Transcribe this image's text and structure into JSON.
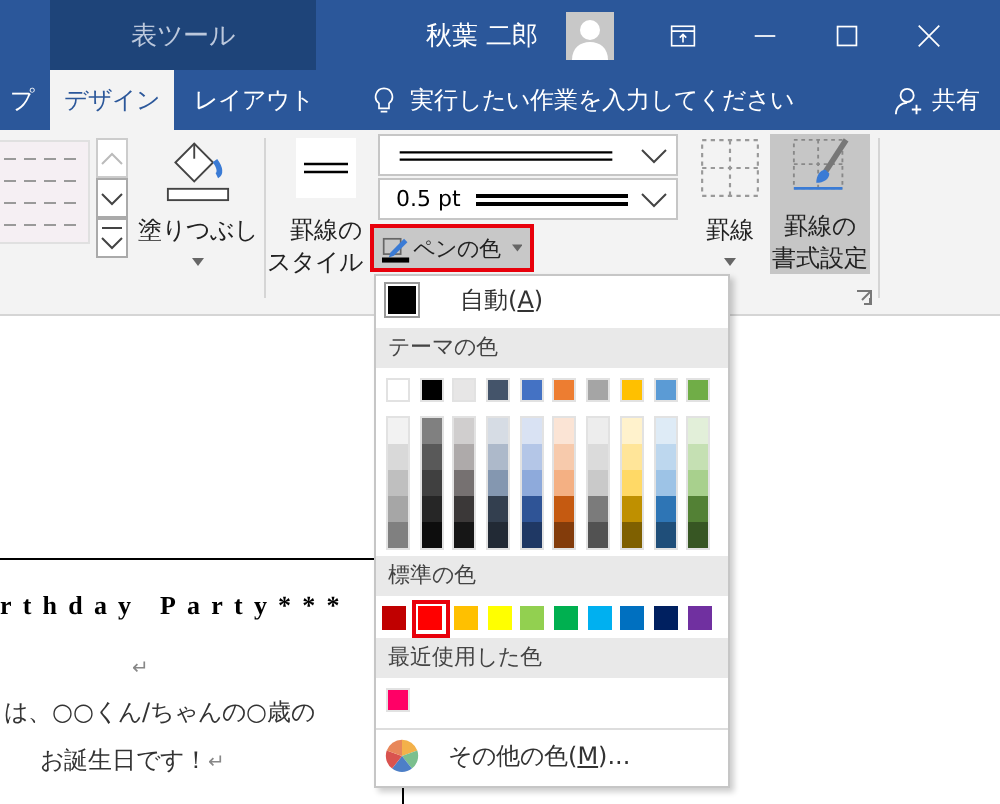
{
  "title_bar": {
    "contextual_tab_group": "表ツール",
    "user_name": "秋葉 二郎"
  },
  "tabs": [
    {
      "label": "プ",
      "selected": false
    },
    {
      "label": "デザイン",
      "selected": true
    },
    {
      "label": "レイアウト",
      "selected": false
    }
  ],
  "tell_me": {
    "placeholder": "実行したい作業を入力してください"
  },
  "share_button": {
    "label": "共有"
  },
  "ribbon": {
    "shading_label": "塗りつぶし",
    "border_styles_label": [
      "罫線の",
      "スタイル"
    ],
    "line_weight": "0.5 pt",
    "pen_color_button": {
      "label": "ペンの色",
      "highlighted": true
    },
    "borders_label": "罫線",
    "border_painter": {
      "label": [
        "罫線の",
        "書式設定"
      ],
      "selected": true
    }
  },
  "color_menu": {
    "automatic": {
      "before": "自動(",
      "key": "A",
      "after": ")",
      "color": "#000000"
    },
    "theme_header": "テーマの色",
    "theme_colors": [
      {
        "color": "#ffffff",
        "shades": [
          {
            "color": "#f2f2f2"
          },
          {
            "color": "#d9d9d9"
          },
          {
            "color": "#bfbfbf"
          },
          {
            "color": "#a6a6a6"
          },
          {
            "color": "#808080"
          }
        ]
      },
      {
        "color": "#000000",
        "shades": [
          {
            "color": "#808080"
          },
          {
            "color": "#595959"
          },
          {
            "color": "#404040"
          },
          {
            "color": "#262626"
          },
          {
            "color": "#0d0d0d"
          }
        ]
      },
      {
        "color": "#e7e6e6",
        "shades": [
          {
            "color": "#d0cece"
          },
          {
            "color": "#aeaaaa"
          },
          {
            "color": "#767171"
          },
          {
            "color": "#3b3838"
          },
          {
            "color": "#161616"
          }
        ]
      },
      {
        "color": "#44546a",
        "shades": [
          {
            "color": "#d6dce4"
          },
          {
            "color": "#adb9ca"
          },
          {
            "color": "#8497b0"
          },
          {
            "color": "#333f4f"
          },
          {
            "color": "#222a35"
          }
        ]
      },
      {
        "color": "#4472c4",
        "shades": [
          {
            "color": "#d9e2f3"
          },
          {
            "color": "#b4c6e7"
          },
          {
            "color": "#8eaadb"
          },
          {
            "color": "#2f5496"
          },
          {
            "color": "#1f3864"
          }
        ]
      },
      {
        "color": "#ed7d31",
        "shades": [
          {
            "color": "#fbe4d5"
          },
          {
            "color": "#f7caac"
          },
          {
            "color": "#f4b083"
          },
          {
            "color": "#c55a11"
          },
          {
            "color": "#833c0b"
          }
        ]
      },
      {
        "color": "#a5a5a5",
        "shades": [
          {
            "color": "#ededed"
          },
          {
            "color": "#dbdbdb"
          },
          {
            "color": "#c9c9c9"
          },
          {
            "color": "#7b7b7b"
          },
          {
            "color": "#525252"
          }
        ]
      },
      {
        "color": "#ffc000",
        "shades": [
          {
            "color": "#fff2cc"
          },
          {
            "color": "#ffe599"
          },
          {
            "color": "#ffd966"
          },
          {
            "color": "#bf9000"
          },
          {
            "color": "#7f6000"
          }
        ]
      },
      {
        "color": "#5b9bd5",
        "shades": [
          {
            "color": "#deebf6"
          },
          {
            "color": "#bdd7ee"
          },
          {
            "color": "#9dc3e6"
          },
          {
            "color": "#2e75b5"
          },
          {
            "color": "#1f4e79"
          }
        ]
      },
      {
        "color": "#70ad47",
        "shades": [
          {
            "color": "#e2efd9"
          },
          {
            "color": "#c5e0b3"
          },
          {
            "color": "#a8d08d"
          },
          {
            "color": "#538135"
          },
          {
            "color": "#375623"
          }
        ]
      }
    ],
    "standard_header": "標準の色",
    "standard_colors": [
      {
        "color": "#c00000",
        "selected": false
      },
      {
        "color": "#ff0000",
        "selected": true
      },
      {
        "color": "#ffc000",
        "selected": false
      },
      {
        "color": "#ffff00",
        "selected": false
      },
      {
        "color": "#92d050",
        "selected": false
      },
      {
        "color": "#00b050",
        "selected": false
      },
      {
        "color": "#00b0f0",
        "selected": false
      },
      {
        "color": "#0070c0",
        "selected": false
      },
      {
        "color": "#002060",
        "selected": false
      },
      {
        "color": "#7030a0",
        "selected": false
      }
    ],
    "recent_header": "最近使用した色",
    "recent_colors": [
      {
        "color": "#ff0066"
      }
    ],
    "more_colors": {
      "before": "その他の色(",
      "key": "M",
      "after": ")..."
    }
  },
  "document": {
    "heading": "rthday Party***",
    "paragraphs": [
      {
        "mark": "↵"
      },
      {
        "text": "は、○○くん/ちゃんの○歳の"
      },
      {
        "text": "お誕生日です！",
        "mark": "↵"
      }
    ]
  }
}
